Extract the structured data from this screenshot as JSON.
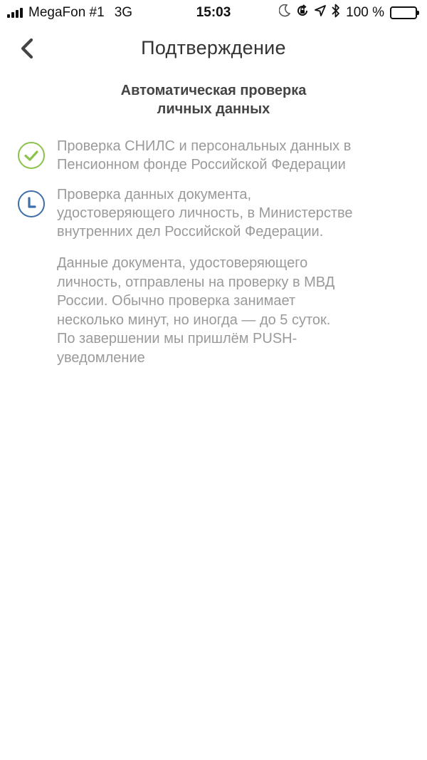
{
  "status_bar": {
    "carrier": "MegaFon #1",
    "network": "3G",
    "time": "15:03",
    "battery": "100 %",
    "icons": [
      "signal-icon",
      "moon-icon",
      "orientation-lock-icon",
      "location-arrow-icon",
      "bluetooth-icon",
      "battery-icon"
    ]
  },
  "nav": {
    "title": "Подтверждение",
    "back_icon": "chevron-left-icon"
  },
  "heading": {
    "line1": "Автоматическая проверка",
    "line2": "личных данных"
  },
  "steps": [
    {
      "status": "done",
      "icon": "check-circle-icon",
      "color": "#8bc34a",
      "line1": "Проверка СНИЛС и персональных данных в",
      "line2": "Пенсионном фонде Российской Федерации"
    },
    {
      "status": "pending",
      "icon": "clock-icon",
      "color": "#3f6fa8",
      "line1": "Проверка данных документа,",
      "line2": "удостоверяющего личность, в Министерстве",
      "line3": "внутренних дел Российской Федерации."
    }
  ],
  "note": {
    "line1": "Данные документа, удостоверяющего",
    "line2": "личность, отправлены на проверку в МВД",
    "line3": "России. Обычно проверка занимает",
    "line4": "несколько минут, но иногда — до 5 суток.",
    "line5": "По завершении мы пришлём PUSH-",
    "line6": "уведомление"
  },
  "colors": {
    "text_primary": "#333333",
    "text_secondary": "#9a9a9a",
    "success": "#8bc34a",
    "pending": "#3f6fa8"
  }
}
